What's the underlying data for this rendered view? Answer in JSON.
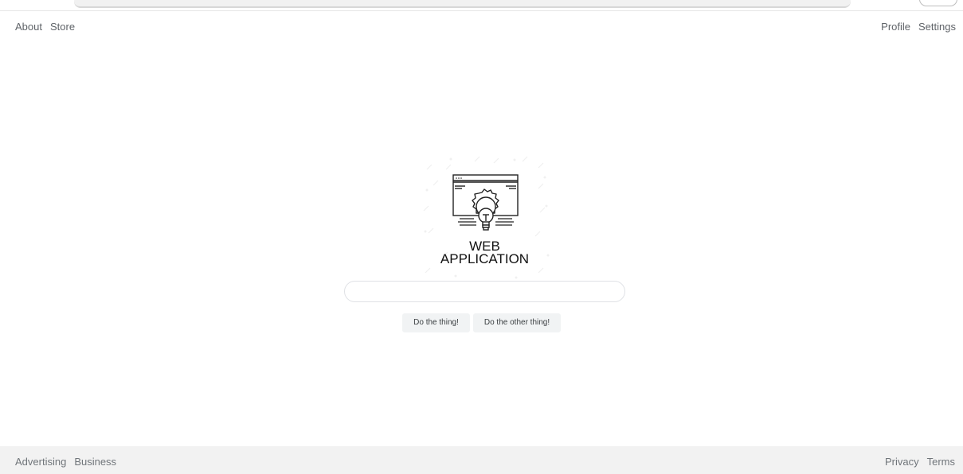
{
  "top_nav": {
    "left": [
      "About",
      "Store"
    ],
    "right": [
      "Profile",
      "Settings"
    ]
  },
  "logo": {
    "line1": "WEB",
    "line2": "APPLICATION",
    "icon": "web-application-gear-bulb-icon"
  },
  "search": {
    "value": "",
    "placeholder": ""
  },
  "buttons": {
    "primary": "Do the thing!",
    "secondary": "Do the other thing!"
  },
  "footer": {
    "left": [
      "Advertising",
      "Business"
    ],
    "right": [
      "Privacy",
      "Terms"
    ]
  },
  "colors": {
    "footer_bg": "#f2f2f2",
    "link": "#5f6368",
    "button_bg": "#f1f3f4",
    "input_border": "#dfe1e5"
  }
}
